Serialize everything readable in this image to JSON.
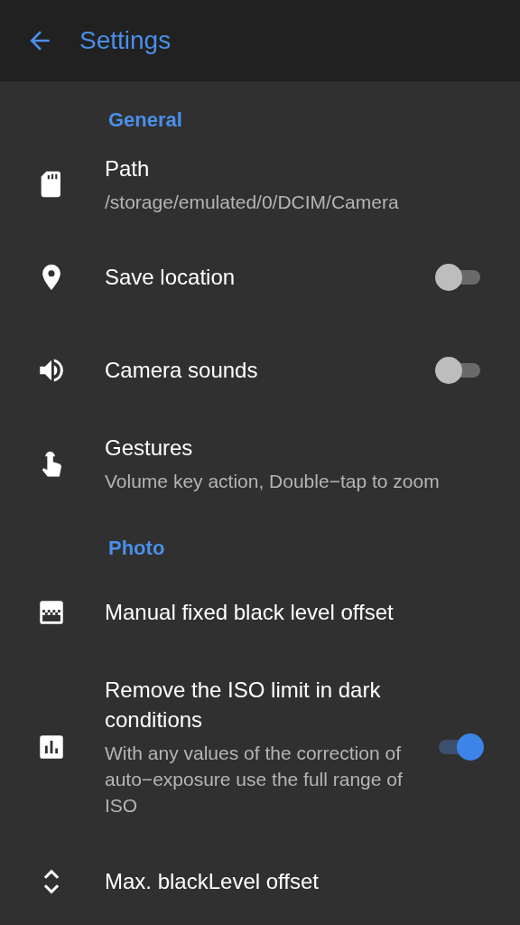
{
  "toolbar": {
    "title": "Settings"
  },
  "sections": [
    {
      "title": "General",
      "items": [
        {
          "kind": "text",
          "title": "Path",
          "summary": "/storage/emulated/0/DCIM/Camera"
        },
        {
          "kind": "switch",
          "title": "Save location",
          "on": false
        },
        {
          "kind": "switch",
          "title": "Camera sounds",
          "on": false
        },
        {
          "kind": "text",
          "title": "Gestures",
          "summary": "Volume key action, Double−tap to zoom"
        }
      ]
    },
    {
      "title": "Photo",
      "items": [
        {
          "kind": "text",
          "title": "Manual fixed black level offset"
        },
        {
          "kind": "switch",
          "title": "Remove the ISO limit in dark conditions",
          "summary": "With any values of the correction of auto−exposure use the full range of ISO",
          "on": true
        },
        {
          "kind": "text",
          "title": "Max. blackLevel offset"
        }
      ]
    }
  ]
}
